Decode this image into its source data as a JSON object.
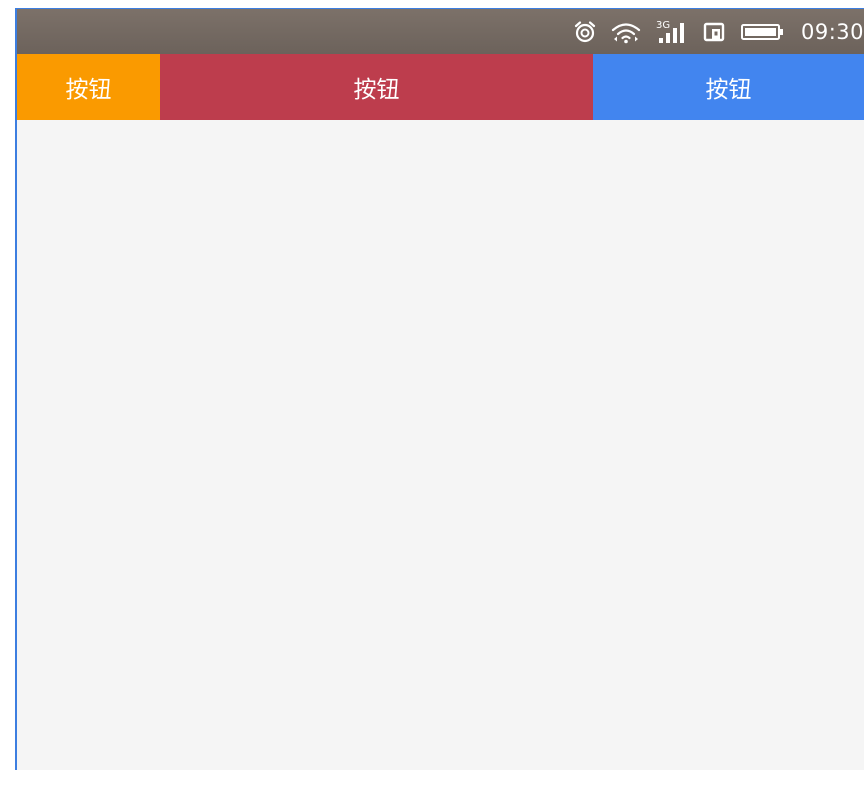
{
  "status_bar": {
    "time": "09:30",
    "network_label": "3G",
    "icons": [
      "alarm-icon",
      "wifi-icon",
      "signal-3g-icon",
      "sim-card-icon",
      "battery-icon"
    ]
  },
  "buttons": [
    {
      "label": "按钮",
      "color": "#fa9a00"
    },
    {
      "label": "按钮",
      "color": "#bd3d4d"
    },
    {
      "label": "按钮",
      "color": "#4285ef"
    }
  ],
  "colors": {
    "status_bar": "#746a63",
    "background": "#f5f5f5",
    "frame_border": "#3c7ee0"
  }
}
